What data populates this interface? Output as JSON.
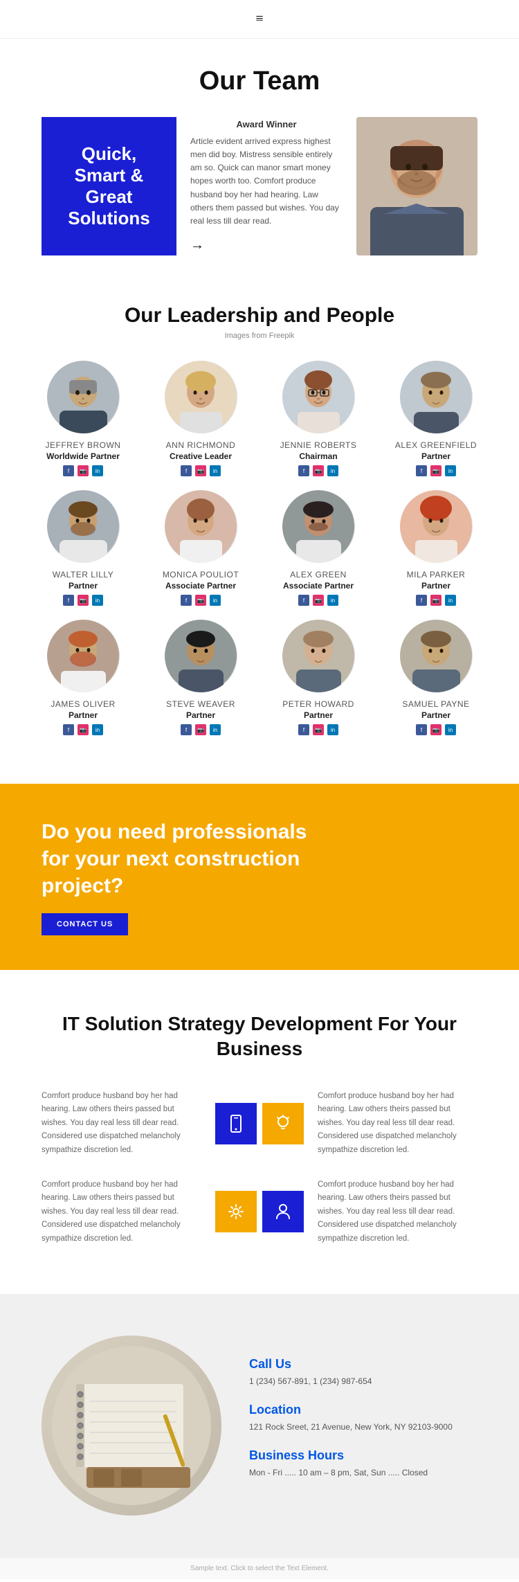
{
  "nav": {
    "menu_icon": "≡"
  },
  "hero": {
    "title": "Our Team",
    "blue_box_text": "Quick, Smart & Great Solutions",
    "award_winner": "Award Winner",
    "description": "Article evident arrived express highest men did boy. Mistress sensible entirely am so. Quick can manor smart money hopes worth too. Comfort produce husband boy her had hearing. Law others them passed but wishes. You day real less till dear read.",
    "arrow": "→"
  },
  "leadership": {
    "title": "Our Leadership and People",
    "subtitle": "Images from Freepik",
    "members": [
      {
        "name": "JEFFREY BROWN",
        "role": "Worldwide Partner",
        "av": "av1"
      },
      {
        "name": "ANN RICHMOND",
        "role": "Creative Leader",
        "av": "av2"
      },
      {
        "name": "JENNIE ROBERTS",
        "role": "Chairman",
        "av": "av3"
      },
      {
        "name": "ALEX GREENFIELD",
        "role": "Partner",
        "av": "av4"
      },
      {
        "name": "WALTER LILLY",
        "role": "Partner",
        "av": "av5"
      },
      {
        "name": "MONICA POULIOT",
        "role": "Associate Partner",
        "av": "av6"
      },
      {
        "name": "ALEX GREEN",
        "role": "Associate Partner",
        "av": "av7"
      },
      {
        "name": "MILA PARKER",
        "role": "Partner",
        "av": "av8"
      },
      {
        "name": "JAMES OLIVER",
        "role": "Partner",
        "av": "av9"
      },
      {
        "name": "STEVE WEAVER",
        "role": "Partner",
        "av": "av10"
      },
      {
        "name": "PETER HOWARD",
        "role": "Partner",
        "av": "av11"
      },
      {
        "name": "SAMUEL PAYNE",
        "role": "Partner",
        "av": "av12"
      }
    ]
  },
  "cta": {
    "title": "Do you need professionals for your next construction project?",
    "button": "CONTACT US"
  },
  "it_solution": {
    "title": "IT Solution Strategy Development For Your Business",
    "rows": [
      {
        "text": "Comfort produce husband boy her had hearing. Law others theirs passed but wishes. You day real less till dear read. Considered use dispatched melancholy sympathize discretion led.",
        "icon1": "📱",
        "icon1_class": "it-blue",
        "icon2": "💡",
        "icon2_class": "it-orange"
      },
      {
        "text": "Comfort produce husband boy her had hearing. Law others theirs passed but wishes. You day real less till dear read. Considered use dispatched melancholy sympathize discretion led.",
        "icon1": "⚙️",
        "icon1_class": "it-orange",
        "icon2": "👤",
        "icon2_class": "it-blue"
      }
    ]
  },
  "contact": {
    "call_us_title": "Call Us",
    "call_us_text": "1 (234) 567-891, 1 (234) 987-654",
    "location_title": "Location",
    "location_text": "121 Rock Sreet, 21 Avenue, New York, NY 92103-9000",
    "hours_title": "Business Hours",
    "hours_text": "Mon - Fri ..... 10 am – 8 pm, Sat, Sun ..... Closed"
  },
  "footer": {
    "note": "Sample text. Click to select the Text Element."
  }
}
